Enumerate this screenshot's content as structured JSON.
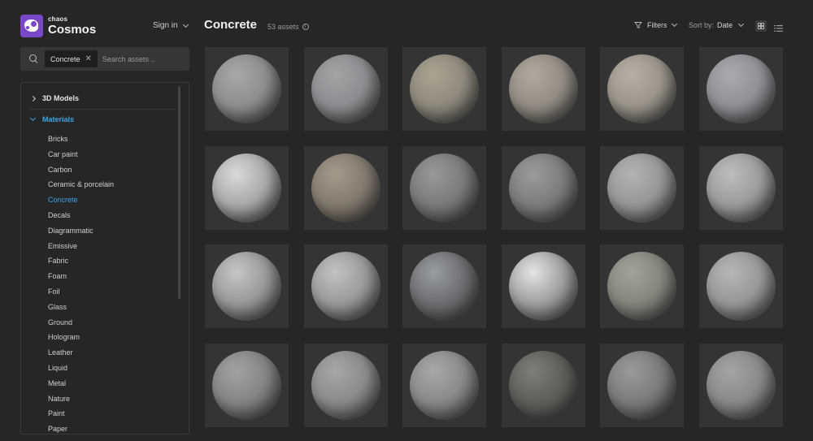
{
  "brand": {
    "small": "chaos",
    "big": "Cosmos"
  },
  "header": {
    "signin": "Sign in",
    "title": "Concrete",
    "count": "53 assets",
    "filters": "Filters",
    "sort_label": "Sort by:",
    "sort_value": "Date"
  },
  "search": {
    "chip": "Concrete",
    "placeholder": "Search assets .."
  },
  "tree": {
    "models": "3D Models",
    "materials": "Materials",
    "items": [
      "Bricks",
      "Car paint",
      "Carbon",
      "Ceramic & porcelain",
      "Concrete",
      "Decals",
      "Diagrammatic",
      "Emissive",
      "Fabric",
      "Foam",
      "Foil",
      "Glass",
      "Ground",
      "Hologram",
      "Leather",
      "Liquid",
      "Metal",
      "Nature",
      "Paint",
      "Paper"
    ],
    "active": "Concrete"
  },
  "icons": {
    "search": "search-icon",
    "clear": "close-icon",
    "info": "info-icon",
    "filter": "filter-icon",
    "grid_view": "grid-view-icon",
    "list_view": "list-view-icon"
  },
  "colors": {
    "accent": "#3aa6e8",
    "brand": "#7b47c9",
    "background": "#262626",
    "tile": "#343434"
  },
  "assets": [
    {
      "tone": "#8e8e8e",
      "hi": "#a8a8a8"
    },
    {
      "tone": "#8c8d90",
      "hi": "#a3a4a6"
    },
    {
      "tone": "#8f8a7c",
      "hi": "#aaa491"
    },
    {
      "tone": "#938d84",
      "hi": "#b0a99e"
    },
    {
      "tone": "#9b958a",
      "hi": "#b6b0a5"
    },
    {
      "tone": "#8f9196",
      "hi": "#a9abb0"
    },
    {
      "tone": "#a9aaab",
      "hi": "#d8d9da"
    },
    {
      "tone": "#857b6e",
      "hi": "#a59a8a"
    },
    {
      "tone": "#7b7b7b",
      "hi": "#989898"
    },
    {
      "tone": "#7d7d7d",
      "hi": "#9b9b9b"
    },
    {
      "tone": "#979797",
      "hi": "#b3b3b3"
    },
    {
      "tone": "#9c9c9c",
      "hi": "#bdbdbd"
    },
    {
      "tone": "#9a9a9a",
      "hi": "#c6c6c6"
    },
    {
      "tone": "#9b9b9b",
      "hi": "#c2c2c2"
    },
    {
      "tone": "#6e7073",
      "hi": "#9a9da0"
    },
    {
      "tone": "#a2a2a2",
      "hi": "#e4e4e4"
    },
    {
      "tone": "#85877e",
      "hi": "#a2a49a"
    },
    {
      "tone": "#989898",
      "hi": "#b6b6b6"
    },
    {
      "tone": "#858585",
      "hi": "#a2a2a2"
    },
    {
      "tone": "#8b8b8b",
      "hi": "#a7a7a7"
    },
    {
      "tone": "#8a8a8a",
      "hi": "#a8a8a8"
    },
    {
      "tone": "#5e605a",
      "hi": "#7c7e77"
    },
    {
      "tone": "#7b7c7d",
      "hi": "#999a9b"
    },
    {
      "tone": "#8a8a8a",
      "hi": "#a4a4a4"
    }
  ]
}
